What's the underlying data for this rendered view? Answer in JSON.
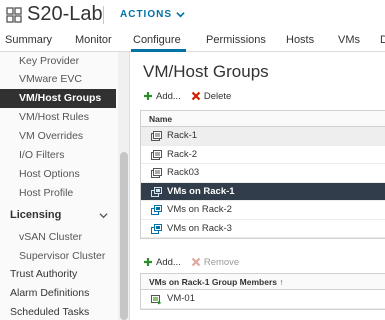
{
  "header": {
    "title": "S20-Lab",
    "actions_label": "ACTIONS",
    "icon": "cluster-icon"
  },
  "tabs": [
    {
      "label": "Summary"
    },
    {
      "label": "Monitor"
    },
    {
      "label": "Configure",
      "active": true
    },
    {
      "label": "Permissions"
    },
    {
      "label": "Hosts"
    },
    {
      "label": "VMs"
    },
    {
      "label": "D"
    }
  ],
  "sidebar": {
    "items": [
      {
        "label": "Key Provider"
      },
      {
        "label": "VMware EVC"
      },
      {
        "label": "VM/Host Groups",
        "selected": true
      },
      {
        "label": "VM/Host Rules"
      },
      {
        "label": "VM Overrides"
      },
      {
        "label": "I/O Filters"
      },
      {
        "label": "Host Options"
      },
      {
        "label": "Host Profile"
      }
    ],
    "group_licensing": "Licensing",
    "licensing_items": [
      {
        "label": "vSAN Cluster"
      },
      {
        "label": "Supervisor Cluster"
      }
    ],
    "top_items": [
      {
        "label": "Trust Authority"
      },
      {
        "label": "Alarm Definitions"
      },
      {
        "label": "Scheduled Tasks"
      }
    ]
  },
  "main": {
    "title": "VM/Host Groups",
    "toolbar": {
      "add_label": "Add...",
      "delete_label": "Delete"
    },
    "groups_table": {
      "header": "Name",
      "rows": [
        {
          "name": "Rack-1",
          "type": "host-group",
          "state": "highlight"
        },
        {
          "name": "Rack-2",
          "type": "host-group",
          "state": ""
        },
        {
          "name": "Rack03",
          "type": "host-group",
          "state": ""
        },
        {
          "name": "VMs on Rack-1",
          "type": "vm-group",
          "state": "selected"
        },
        {
          "name": "VMs on Rack-2",
          "type": "vm-group",
          "state": ""
        },
        {
          "name": "VMs on Rack-3",
          "type": "vm-group",
          "state": ""
        }
      ]
    },
    "members_toolbar": {
      "add_label": "Add...",
      "remove_label": "Remove"
    },
    "members_table": {
      "header": "VMs on Rack-1 Group Members",
      "sort_glyph": "↑",
      "rows": [
        {
          "name": "VM-01",
          "type": "vm"
        }
      ]
    }
  },
  "colors": {
    "accent": "#0072a3",
    "add_green": "#2e8b2e",
    "delete_red": "#c92100",
    "selected_row": "#313d4a",
    "sidebar_selected": "#313131"
  }
}
